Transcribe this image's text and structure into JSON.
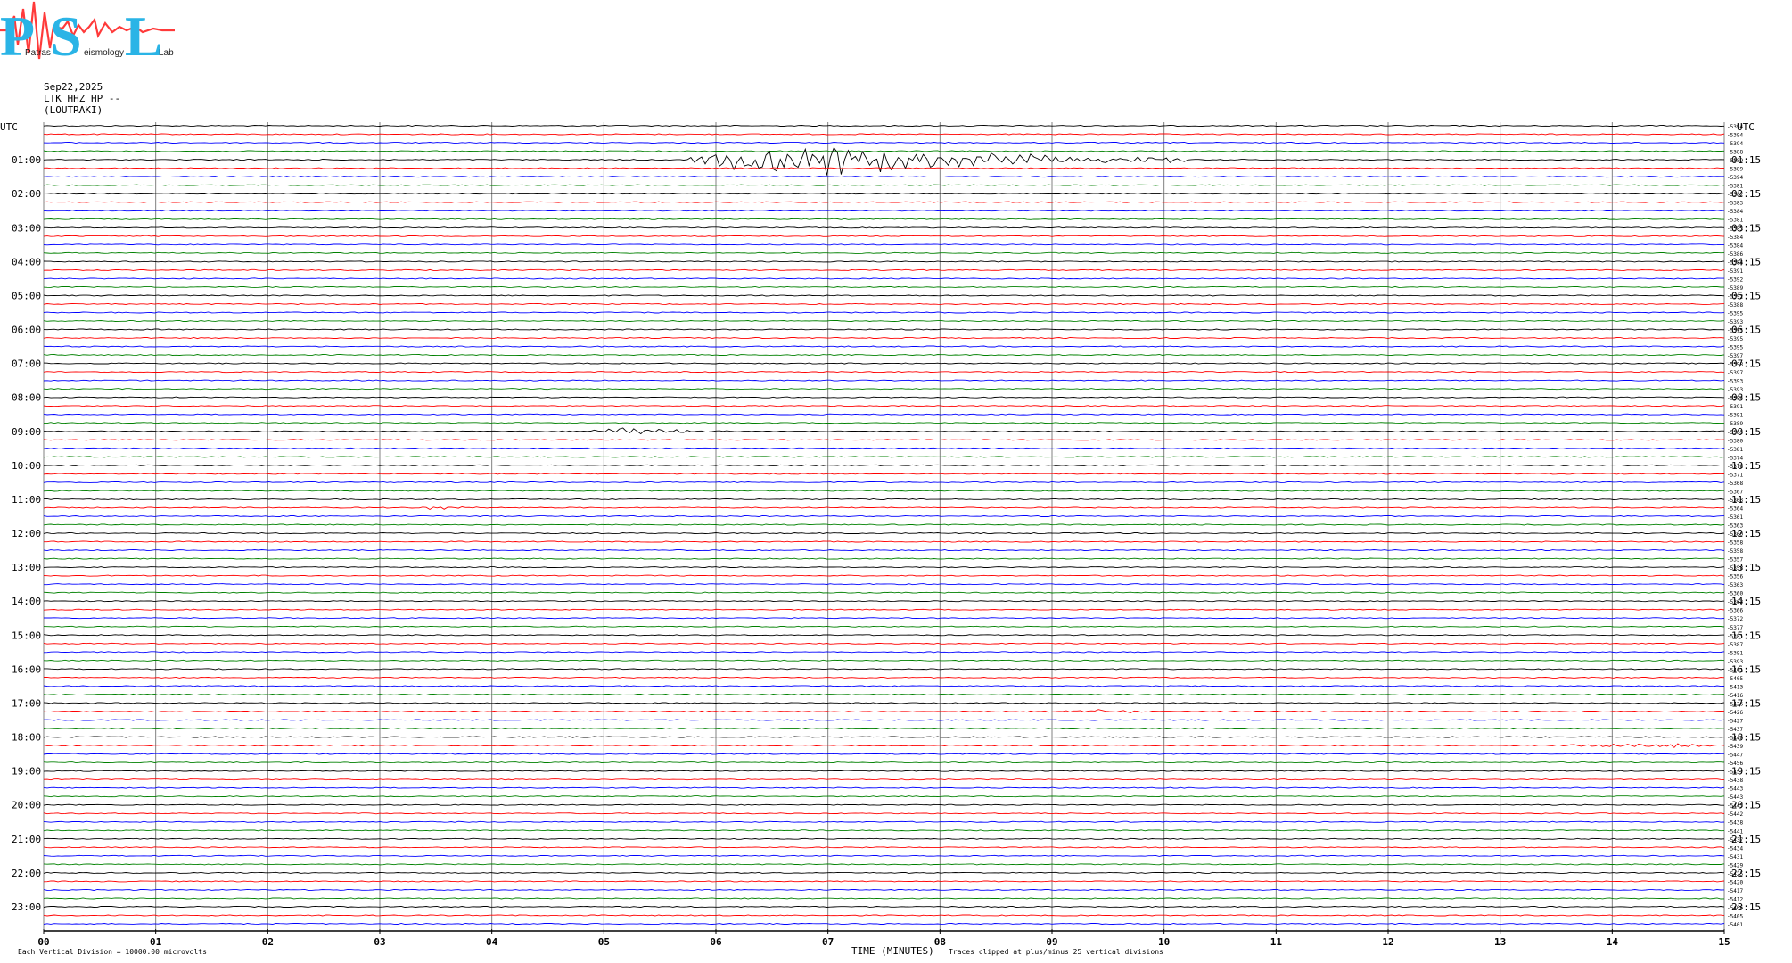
{
  "logo": {
    "letters": [
      "P",
      "S",
      "L"
    ],
    "subtitle_fragments": [
      "Patras",
      "eismology",
      "Lab"
    ]
  },
  "header": {
    "date": "Sep22,2025",
    "station": "LTK HHZ HP --",
    "location": "(LOUTRAKI)"
  },
  "footer": {
    "left_note": "Each Vertical Division = 10000.00 microvolts",
    "clip_note": "Traces clipped at plus/minus 25 vertical divisions"
  },
  "colors": {
    "black": "#000000",
    "red": "#ff0000",
    "blue": "#0000ff",
    "green": "#008000",
    "grid": "#808080"
  },
  "chart_data": {
    "type": "line",
    "chart_kind": "helicorder",
    "xlabel": "TIME (MINUTES)",
    "x_ticks": [
      "00",
      "01",
      "02",
      "03",
      "04",
      "05",
      "06",
      "07",
      "08",
      "09",
      "10",
      "11",
      "12",
      "13",
      "14",
      "15"
    ],
    "xlim": [
      0,
      15
    ],
    "left_axis_label": "UTC",
    "right_axis_label": "UTC",
    "rows_per_hour": 4,
    "minutes_per_row": 15,
    "trace_color_cycle": [
      "black",
      "red",
      "blue",
      "green"
    ],
    "left_hour_labels": [
      "01:00",
      "02:00",
      "03:00",
      "04:00",
      "05:00",
      "06:00",
      "07:00",
      "08:00",
      "09:00",
      "10:00",
      "11:00",
      "12:00",
      "13:00",
      "14:00",
      "15:00",
      "16:00",
      "17:00",
      "18:00",
      "19:00",
      "20:00",
      "21:00",
      "22:00",
      "23:00"
    ],
    "right_hour_labels": [
      "01:15",
      "02:15",
      "03:15",
      "04:15",
      "05:15",
      "06:15",
      "07:15",
      "08:15",
      "09:15",
      "10:15",
      "11:15",
      "12:15",
      "13:15",
      "14:15",
      "15:15",
      "16:15",
      "17:15",
      "18:15",
      "19:15",
      "20:15",
      "21:15",
      "22:15",
      "23:15"
    ],
    "row_offsets": [
      "-5394",
      "-5394",
      "-5394",
      "-5388",
      "-5389",
      "-5389",
      "-5394",
      "-5381",
      "-5382",
      "-5383",
      "-5384",
      "-5381",
      "-5383",
      "-5384",
      "-5384",
      "-5386",
      "-5384",
      "-5391",
      "-5392",
      "-5389",
      "-5392",
      "-5388",
      "-5395",
      "-5393",
      "-5395",
      "-5395",
      "-5395",
      "-5397",
      "-5398",
      "-5397",
      "-5393",
      "-5393",
      "-5394",
      "-5391",
      "-5391",
      "-5389",
      "-5385",
      "-5380",
      "-5381",
      "-5374",
      "-5378",
      "-5371",
      "-5368",
      "-5367",
      "-5363",
      "-5364",
      "-5361",
      "-5363",
      "-5360",
      "-5358",
      "-5358",
      "-5357",
      "-5358",
      "-5356",
      "-5363",
      "-5360",
      "-5362",
      "-5366",
      "-5372",
      "-5377",
      "-5381",
      "-5387",
      "-5391",
      "-5393",
      "-5401",
      "-5405",
      "-5413",
      "-5416",
      "-5426",
      "-5426",
      "-5427",
      "-5437",
      "-5440",
      "-5439",
      "-5447",
      "-5456",
      "-5457",
      "-5438",
      "-5443",
      "-5443",
      "-5445",
      "-5442",
      "-5438",
      "-5441",
      "-5437",
      "-5434",
      "-5431",
      "-5429",
      "-5425",
      "-5420",
      "-5417",
      "-5412",
      "-5406",
      "-5405",
      "-5401"
    ],
    "events": [
      {
        "row": 4,
        "start_minute": 5.6,
        "end_minute": 10.2,
        "peak_minute": 6.7,
        "amplitude_divisions": 1.5,
        "color": "red"
      },
      {
        "row": 36,
        "start_minute": 4.8,
        "end_minute": 6.1,
        "peak_minute": 5.2,
        "amplitude_divisions": 0.35,
        "color": "black"
      },
      {
        "row": 45,
        "start_minute": 3.2,
        "end_minute": 4.0,
        "peak_minute": 3.5,
        "amplitude_divisions": 0.2,
        "color": "red"
      },
      {
        "row": 73,
        "start_minute": 13.5,
        "end_minute": 15.0,
        "peak_minute": 14.4,
        "amplitude_divisions": 0.3,
        "color": "black"
      },
      {
        "row": 69,
        "start_minute": 8.6,
        "end_minute": 10.0,
        "peak_minute": 9.5,
        "amplitude_divisions": 0.2,
        "color": "red"
      }
    ],
    "grid": true
  }
}
